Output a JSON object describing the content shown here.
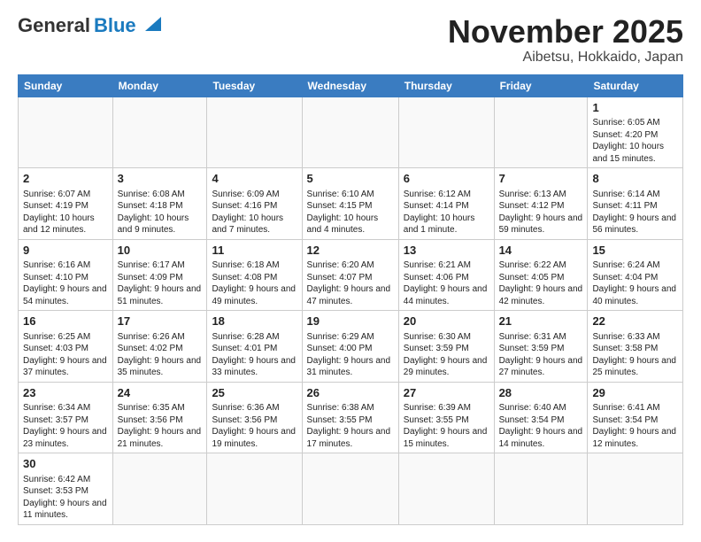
{
  "header": {
    "logo_general": "General",
    "logo_blue": "Blue",
    "title": "November 2025",
    "subtitle": "Aibetsu, Hokkaido, Japan"
  },
  "weekdays": [
    "Sunday",
    "Monday",
    "Tuesday",
    "Wednesday",
    "Thursday",
    "Friday",
    "Saturday"
  ],
  "weeks": [
    [
      {
        "day": "",
        "info": ""
      },
      {
        "day": "",
        "info": ""
      },
      {
        "day": "",
        "info": ""
      },
      {
        "day": "",
        "info": ""
      },
      {
        "day": "",
        "info": ""
      },
      {
        "day": "",
        "info": ""
      },
      {
        "day": "1",
        "info": "Sunrise: 6:05 AM\nSunset: 4:20 PM\nDaylight: 10 hours and 15 minutes."
      }
    ],
    [
      {
        "day": "2",
        "info": "Sunrise: 6:07 AM\nSunset: 4:19 PM\nDaylight: 10 hours and 12 minutes."
      },
      {
        "day": "3",
        "info": "Sunrise: 6:08 AM\nSunset: 4:18 PM\nDaylight: 10 hours and 9 minutes."
      },
      {
        "day": "4",
        "info": "Sunrise: 6:09 AM\nSunset: 4:16 PM\nDaylight: 10 hours and 7 minutes."
      },
      {
        "day": "5",
        "info": "Sunrise: 6:10 AM\nSunset: 4:15 PM\nDaylight: 10 hours and 4 minutes."
      },
      {
        "day": "6",
        "info": "Sunrise: 6:12 AM\nSunset: 4:14 PM\nDaylight: 10 hours and 1 minute."
      },
      {
        "day": "7",
        "info": "Sunrise: 6:13 AM\nSunset: 4:12 PM\nDaylight: 9 hours and 59 minutes."
      },
      {
        "day": "8",
        "info": "Sunrise: 6:14 AM\nSunset: 4:11 PM\nDaylight: 9 hours and 56 minutes."
      }
    ],
    [
      {
        "day": "9",
        "info": "Sunrise: 6:16 AM\nSunset: 4:10 PM\nDaylight: 9 hours and 54 minutes."
      },
      {
        "day": "10",
        "info": "Sunrise: 6:17 AM\nSunset: 4:09 PM\nDaylight: 9 hours and 51 minutes."
      },
      {
        "day": "11",
        "info": "Sunrise: 6:18 AM\nSunset: 4:08 PM\nDaylight: 9 hours and 49 minutes."
      },
      {
        "day": "12",
        "info": "Sunrise: 6:20 AM\nSunset: 4:07 PM\nDaylight: 9 hours and 47 minutes."
      },
      {
        "day": "13",
        "info": "Sunrise: 6:21 AM\nSunset: 4:06 PM\nDaylight: 9 hours and 44 minutes."
      },
      {
        "day": "14",
        "info": "Sunrise: 6:22 AM\nSunset: 4:05 PM\nDaylight: 9 hours and 42 minutes."
      },
      {
        "day": "15",
        "info": "Sunrise: 6:24 AM\nSunset: 4:04 PM\nDaylight: 9 hours and 40 minutes."
      }
    ],
    [
      {
        "day": "16",
        "info": "Sunrise: 6:25 AM\nSunset: 4:03 PM\nDaylight: 9 hours and 37 minutes."
      },
      {
        "day": "17",
        "info": "Sunrise: 6:26 AM\nSunset: 4:02 PM\nDaylight: 9 hours and 35 minutes."
      },
      {
        "day": "18",
        "info": "Sunrise: 6:28 AM\nSunset: 4:01 PM\nDaylight: 9 hours and 33 minutes."
      },
      {
        "day": "19",
        "info": "Sunrise: 6:29 AM\nSunset: 4:00 PM\nDaylight: 9 hours and 31 minutes."
      },
      {
        "day": "20",
        "info": "Sunrise: 6:30 AM\nSunset: 3:59 PM\nDaylight: 9 hours and 29 minutes."
      },
      {
        "day": "21",
        "info": "Sunrise: 6:31 AM\nSunset: 3:59 PM\nDaylight: 9 hours and 27 minutes."
      },
      {
        "day": "22",
        "info": "Sunrise: 6:33 AM\nSunset: 3:58 PM\nDaylight: 9 hours and 25 minutes."
      }
    ],
    [
      {
        "day": "23",
        "info": "Sunrise: 6:34 AM\nSunset: 3:57 PM\nDaylight: 9 hours and 23 minutes."
      },
      {
        "day": "24",
        "info": "Sunrise: 6:35 AM\nSunset: 3:56 PM\nDaylight: 9 hours and 21 minutes."
      },
      {
        "day": "25",
        "info": "Sunrise: 6:36 AM\nSunset: 3:56 PM\nDaylight: 9 hours and 19 minutes."
      },
      {
        "day": "26",
        "info": "Sunrise: 6:38 AM\nSunset: 3:55 PM\nDaylight: 9 hours and 17 minutes."
      },
      {
        "day": "27",
        "info": "Sunrise: 6:39 AM\nSunset: 3:55 PM\nDaylight: 9 hours and 15 minutes."
      },
      {
        "day": "28",
        "info": "Sunrise: 6:40 AM\nSunset: 3:54 PM\nDaylight: 9 hours and 14 minutes."
      },
      {
        "day": "29",
        "info": "Sunrise: 6:41 AM\nSunset: 3:54 PM\nDaylight: 9 hours and 12 minutes."
      }
    ],
    [
      {
        "day": "30",
        "info": "Sunrise: 6:42 AM\nSunset: 3:53 PM\nDaylight: 9 hours and 11 minutes."
      },
      {
        "day": "",
        "info": ""
      },
      {
        "day": "",
        "info": ""
      },
      {
        "day": "",
        "info": ""
      },
      {
        "day": "",
        "info": ""
      },
      {
        "day": "",
        "info": ""
      },
      {
        "day": "",
        "info": ""
      }
    ]
  ]
}
